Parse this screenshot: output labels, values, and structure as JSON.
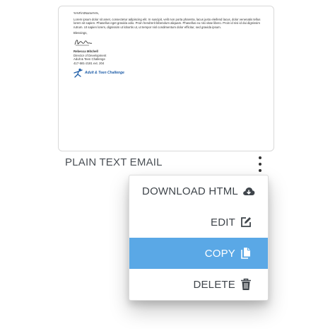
{
  "preview": {
    "greeting": "%%FirstName%%,",
    "body": "Lorem ipsum dolor sit amet, consectetur adipiscing elit. In suscipit, velit non porta pharetra, lacus justo eleifend lacus, dolor venenatis tellus lorem sit sapien. Phasellus eget gravida odio. Proin hendrerit bibendum aliquam. Phasellus eu nisi vitae libero. Proin id nisi id dui dignissim rutrum. Ut sapien lorem, dignissim ut lobortis ut, ut tempor nisl condimentum dolor efficitur, sed gravida ipsum.",
    "blessing": "Blessings,",
    "signature_name": "Rebecca Mitchell",
    "signature_title": "Director of Development",
    "signature_org": "Adult & Teen Challenge",
    "signature_phone": "417-581-2181 ext. 204",
    "logo_text": "Adult & Teen Challenge"
  },
  "card": {
    "title": "PLAIN TEXT EMAIL"
  },
  "menu": {
    "items": [
      {
        "label": "DOWNLOAD HTML",
        "icon": "cloud-download-icon"
      },
      {
        "label": "EDIT",
        "icon": "edit-icon"
      },
      {
        "label": "COPY",
        "icon": "copy-icon",
        "active": true
      },
      {
        "label": "DELETE",
        "icon": "trash-icon"
      }
    ],
    "active_color": "#5aa8e6"
  }
}
